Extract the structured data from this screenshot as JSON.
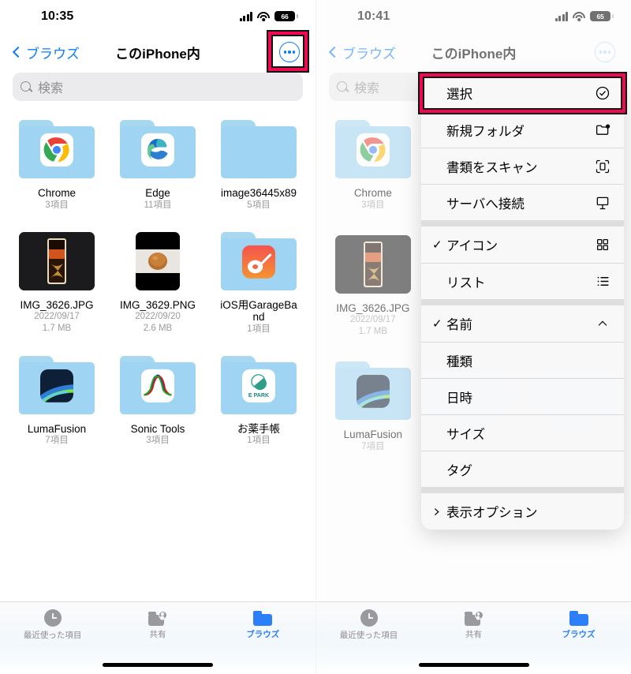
{
  "highlight_color": "#ED0A52",
  "accent_color": "#0a7cff",
  "panels": [
    {
      "id": "left",
      "status": {
        "time": "10:35",
        "battery": "66",
        "signal_icon": "cellular-bars-icon",
        "wifi_icon": "wifi-icon",
        "battery_icon": "battery-icon"
      },
      "nav": {
        "back_label": "ブラウズ",
        "title": "このiPhone内",
        "more_icon": "ellipsis-circle-icon"
      },
      "search": {
        "placeholder": "検索",
        "icon": "search-icon"
      },
      "files": [
        {
          "name": "Chrome",
          "meta": "3項目",
          "meta2": "",
          "kind": "folder",
          "icon": "chrome-icon"
        },
        {
          "name": "Edge",
          "meta": "11項目",
          "meta2": "",
          "kind": "folder",
          "icon": "edge-icon"
        },
        {
          "name": "image36445x89",
          "meta": "5項目",
          "meta2": "",
          "kind": "folder",
          "icon": "none"
        },
        {
          "name": "IMG_3626.JPG",
          "meta": "2022/09/17",
          "meta2": "1.7 MB",
          "kind": "photo",
          "icon": "iphone-box-photo"
        },
        {
          "name": "IMG_3629.PNG",
          "meta": "2022/09/20",
          "meta2": "2.6 MB",
          "kind": "photo",
          "icon": "bread-photo"
        },
        {
          "name": "iOS用GarageBand",
          "meta": "1項目",
          "meta2": "",
          "kind": "folder",
          "icon": "garageband-icon"
        },
        {
          "name": "LumaFusion",
          "meta": "7項目",
          "meta2": "",
          "kind": "folder",
          "icon": "lumafusion-icon"
        },
        {
          "name": "Sonic Tools",
          "meta": "3項目",
          "meta2": "",
          "kind": "folder",
          "icon": "sonictools-icon"
        },
        {
          "name": "お薬手帳",
          "meta": "1項目",
          "meta2": "",
          "kind": "folder",
          "icon": "epark-icon"
        }
      ],
      "tabs": [
        {
          "label": "最近使った項目",
          "icon": "clock-icon",
          "active": false
        },
        {
          "label": "共有",
          "icon": "shared-folder-icon",
          "active": false
        },
        {
          "label": "ブラウズ",
          "icon": "folder-icon",
          "active": true
        }
      ]
    },
    {
      "id": "right",
      "status": {
        "time": "10:41",
        "battery": "65",
        "signal_icon": "cellular-bars-icon",
        "wifi_icon": "wifi-icon",
        "battery_icon": "battery-icon"
      },
      "nav": {
        "back_label": "ブラウズ",
        "title": "このiPhone内",
        "more_icon": "ellipsis-circle-icon"
      },
      "search": {
        "placeholder": "検索",
        "icon": "search-icon"
      },
      "files": [
        {
          "name": "Chrome",
          "meta": "3項目",
          "meta2": "",
          "kind": "folder",
          "icon": "chrome-icon"
        },
        {
          "name": "IMG_3626.JPG",
          "meta": "2022/09/17",
          "meta2": "1.7 MB",
          "kind": "photo",
          "icon": "iphone-box-photo"
        },
        {
          "name": "LumaFusion",
          "meta": "7項目",
          "meta2": "",
          "kind": "folder",
          "icon": "lumafusion-icon"
        },
        {
          "name": "Sonic Tools",
          "meta": "3項目",
          "meta2": "",
          "kind": "folder",
          "icon": "sonictools-icon"
        },
        {
          "name": "お薬手帳",
          "meta": "1項目",
          "meta2": "",
          "kind": "folder",
          "icon": "epark-icon"
        }
      ],
      "tabs": [
        {
          "label": "最近使った項目",
          "icon": "clock-icon",
          "active": false
        },
        {
          "label": "共有",
          "icon": "shared-folder-icon",
          "active": false
        },
        {
          "label": "ブラウズ",
          "icon": "folder-icon",
          "active": true
        }
      ]
    }
  ],
  "context_menu": {
    "groups": [
      {
        "items": [
          {
            "label": "選択",
            "icon": "check-circle-icon",
            "checked": false,
            "highlighted": true
          },
          {
            "label": "新規フォルダ",
            "icon": "new-folder-icon",
            "checked": false,
            "highlighted": false
          },
          {
            "label": "書類をスキャン",
            "icon": "scan-document-icon",
            "checked": false,
            "highlighted": false
          },
          {
            "label": "サーバへ接続",
            "icon": "server-connect-icon",
            "checked": false,
            "highlighted": false
          }
        ]
      },
      {
        "items": [
          {
            "label": "アイコン",
            "icon": "grid-view-icon",
            "checked": true,
            "highlighted": false
          },
          {
            "label": "リスト",
            "icon": "list-view-icon",
            "checked": false,
            "highlighted": false
          }
        ]
      },
      {
        "items": [
          {
            "label": "名前",
            "icon": "chevron-up-icon",
            "checked": true,
            "highlighted": false
          },
          {
            "label": "種類",
            "icon": "none",
            "checked": false,
            "highlighted": false
          },
          {
            "label": "日時",
            "icon": "none",
            "checked": false,
            "highlighted": false
          },
          {
            "label": "サイズ",
            "icon": "none",
            "checked": false,
            "highlighted": false
          },
          {
            "label": "タグ",
            "icon": "none",
            "checked": false,
            "highlighted": false
          }
        ]
      },
      {
        "items": [
          {
            "label": "表示オプション",
            "icon": "none",
            "leading_icon": "chevron-right-icon",
            "checked": false,
            "highlighted": false
          }
        ]
      }
    ]
  }
}
